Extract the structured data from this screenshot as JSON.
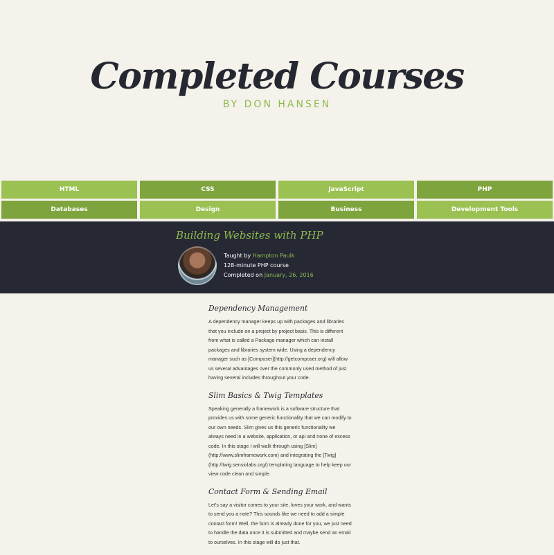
{
  "header": {
    "title": "Completed Courses",
    "byline": "BY DON HANSEN"
  },
  "nav": {
    "items": [
      {
        "label": "HTML",
        "tone": "light"
      },
      {
        "label": "CSS",
        "tone": "dark"
      },
      {
        "label": "JavaScript",
        "tone": "light"
      },
      {
        "label": "PHP",
        "tone": "dark"
      },
      {
        "label": "Databases",
        "tone": "dark"
      },
      {
        "label": "Design",
        "tone": "light"
      },
      {
        "label": "Business",
        "tone": "dark"
      },
      {
        "label": "Development Tools",
        "tone": "light"
      }
    ]
  },
  "course": {
    "title": "Building Websites with PHP",
    "taught_by_prefix": "Taught by ",
    "instructor": "Hampton Paulk",
    "minutes": "128-minute PHP course",
    "completed_prefix": "Completed on ",
    "completed_date": "January, 26, 2016",
    "avatar_icon": "person-avatar-icon"
  },
  "sections": [
    {
      "title": "Dependency Management",
      "body": "A dependency manager keeps up with packages and libraries that you include on a project by project basis. This is different from what is called a Package manager which can install packages and libraries system wide. Using a dependency manager such as [Composer](http://getcomposer.org) will allow us several advantages over the commonly used method of just having several includes throughout your code."
    },
    {
      "title": "Slim Basics & Twig Templates",
      "body": "Speaking generally a framework is a software structure that provides us with some generic functionality that we can modify to our own needs. Slim gives us this generic functionality we always need in a website, application, or api and none of excess code. In this stage I will walk through using [Slim](http://www.slimframework.com) and integrating the [Twig](http://twig.sensiolabs.org/) templating language to help keep our view code clean and simple."
    },
    {
      "title": "Contact Form & Sending Email",
      "body": "Let's say a visitor comes to your site, loves your work, and wants to send you a note? This sounds like we need to add a simple contact form! Well, the form is already done for you, we just need to handle the data once it is submitted and maybe send an email to ourselves. In this stage will do just that."
    }
  ],
  "colors": {
    "background": "#f5f2eb",
    "ink": "#262831",
    "green_light": "#9ac152",
    "green_dark": "#7ea43d",
    "accent": "#8dbb4f",
    "banner": "#262834"
  }
}
